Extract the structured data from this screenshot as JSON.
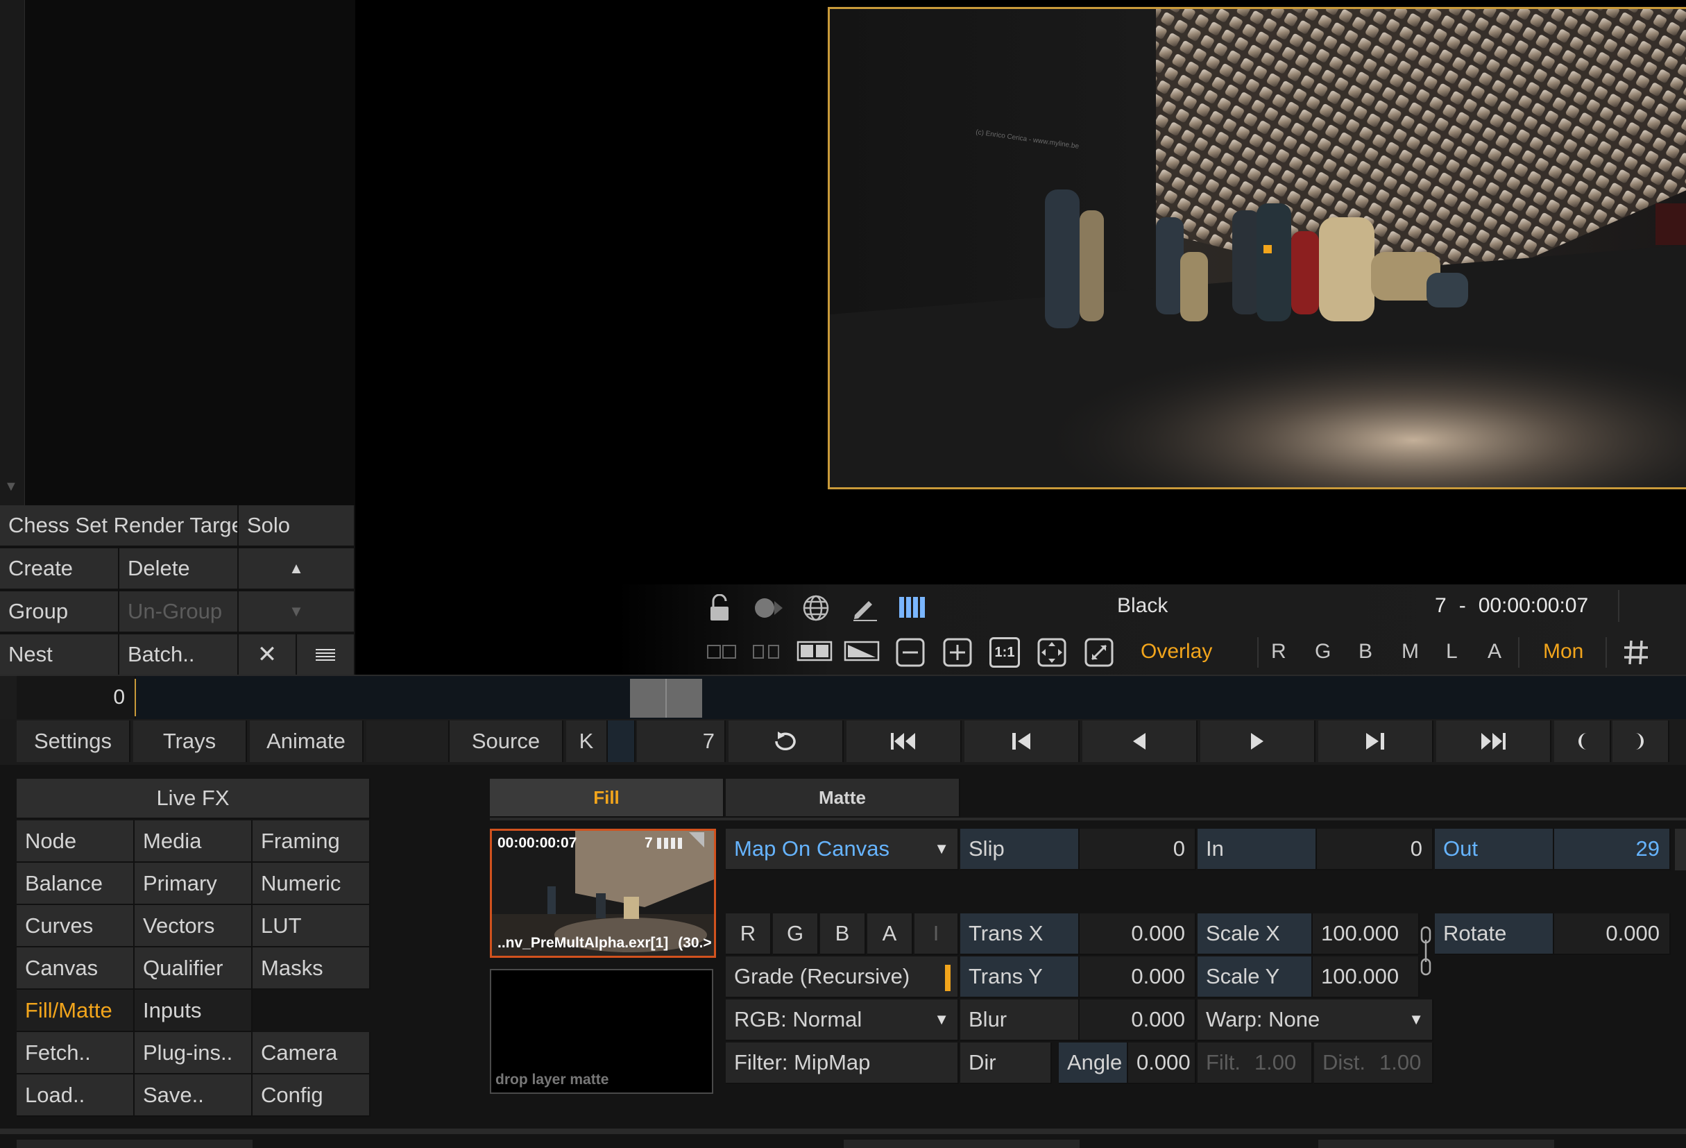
{
  "layer_panel": {
    "layer_name": "Chess Set Render Targe",
    "solo": "Solo",
    "create": "Create",
    "delete": "Delete",
    "group": "Group",
    "ungroup": "Un-Group",
    "nest": "Nest",
    "batch": "Batch.."
  },
  "viewer": {
    "image_alt": "chess pieces render",
    "watermark": "(c) Enrico Cerica - www.myline.be"
  },
  "viewer_toolbar": {
    "background_label": "Black",
    "frame_number": "7",
    "separator": "-",
    "timecode": "00:00:00:07",
    "overlay": "Overlay",
    "channels": [
      "R",
      "G",
      "B",
      "M",
      "L",
      "A"
    ],
    "mon": "Mon",
    "zoom_1to1": "1:1"
  },
  "timeline": {
    "start_frame": "0"
  },
  "transport": {
    "tabs": [
      "Settings",
      "Trays",
      "Animate"
    ],
    "source": "Source",
    "key": "K",
    "current_frame": "7"
  },
  "menu": {
    "title": "Live FX",
    "items": [
      [
        "Node",
        "Media",
        "Framing"
      ],
      [
        "Balance",
        "Primary",
        "Numeric"
      ],
      [
        "Curves",
        "Vectors",
        "LUT"
      ],
      [
        "Canvas",
        "Qualifier",
        "Masks"
      ],
      [
        "Fill/Matte",
        "Inputs",
        ""
      ],
      [
        "Fetch..",
        "Plug-ins..",
        "Camera"
      ],
      [
        "Load..",
        "Save..",
        "Config"
      ]
    ]
  },
  "fill_matte": {
    "tab_fill": "Fill",
    "tab_matte": "Matte",
    "thumb_timecode": "00:00:00:07",
    "thumb_frame": "7",
    "thumb_filename": "..nv_PreMultAlpha.exr[1]",
    "thumb_suffix": "(30.>",
    "drop_matte": "drop layer matte",
    "map_mode": "Map On Canvas",
    "slip_label": "Slip",
    "slip_value": "0",
    "in_label": "In",
    "in_value": "0",
    "out_label": "Out",
    "out_value": "29",
    "rgba": [
      "R",
      "G",
      "B",
      "A",
      "I"
    ],
    "grade": "Grade (Recursive)",
    "rgb_mode": "RGB: Normal",
    "filter": "Filter: MipMap",
    "trans_x_label": "Trans X",
    "trans_x": "0.000",
    "trans_y_label": "Trans Y",
    "trans_y": "0.000",
    "blur_label": "Blur",
    "blur": "0.000",
    "dir_label": "Dir",
    "angle_label": "Angle",
    "angle": "0.000",
    "scale_x_label": "Scale X",
    "scale_x": "100.000",
    "scale_y_label": "Scale Y",
    "scale_y": "100.000",
    "warp": "Warp: None",
    "filt_label": "Filt.",
    "filt": "1.00",
    "dist_label": "Dist.",
    "dist": "1.00",
    "rotate_label": "Rotate",
    "rotate": "0.000"
  },
  "colors": {
    "accent_orange": "#f2a51c",
    "accent_blue": "#66b4ff",
    "viewer_border": "#c99a3a"
  }
}
